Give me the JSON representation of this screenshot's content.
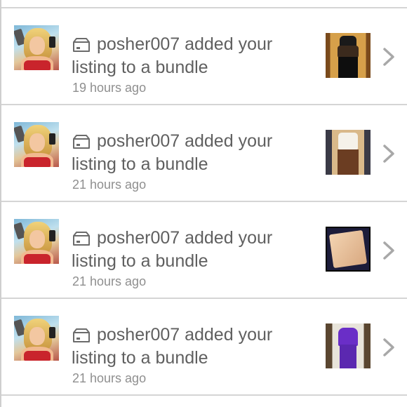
{
  "notifications": [
    {
      "line1": "posher007 added your",
      "line2": "listing to a bundle",
      "time": "19 hours ago"
    },
    {
      "line1": "posher007 added your",
      "line2": "listing to a bundle",
      "time": "21 hours ago"
    },
    {
      "line1": "posher007 added your",
      "line2": "listing to a bundle",
      "time": "21 hours ago"
    },
    {
      "line1": "posher007 added your",
      "line2": "listing to a bundle",
      "time": "21 hours ago"
    }
  ],
  "icons": {
    "type_icon": "package-icon",
    "chevron": "chevron-right-icon"
  },
  "colors": {
    "text": "#606060",
    "time": "#8f8f8f",
    "separator": "#d5d5d5"
  }
}
